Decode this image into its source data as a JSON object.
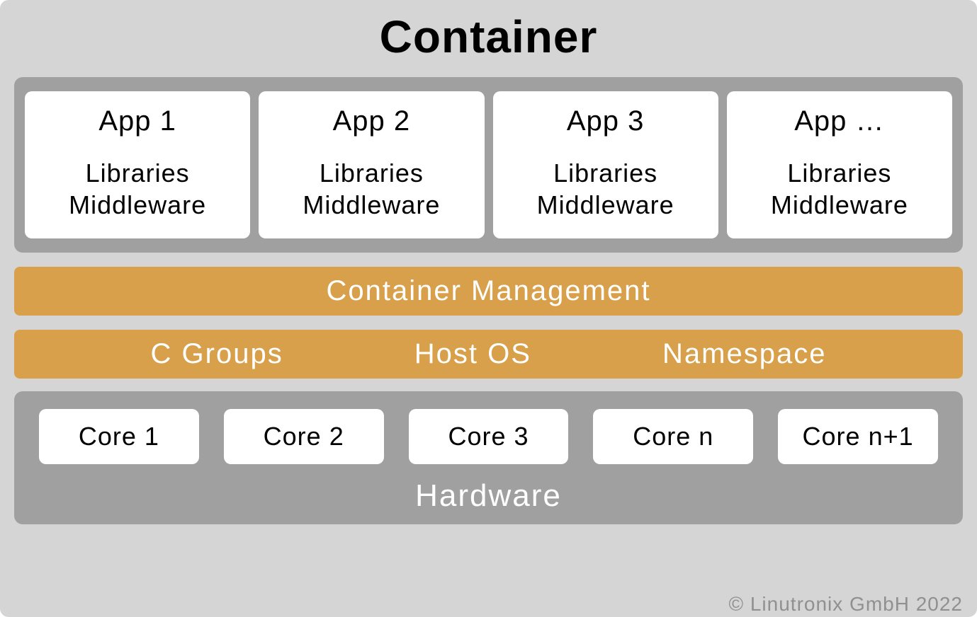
{
  "title": "Container",
  "apps": [
    {
      "name": "App 1",
      "line1": "Libraries",
      "line2": "Middleware"
    },
    {
      "name": "App 2",
      "line1": "Libraries",
      "line2": "Middleware"
    },
    {
      "name": "App 3",
      "line1": "Libraries",
      "line2": "Middleware"
    },
    {
      "name": "App …",
      "line1": "Libraries",
      "line2": "Middleware"
    }
  ],
  "management": "Container Management",
  "os_items": [
    "C Groups",
    "Host OS",
    "Namespace"
  ],
  "cores": [
    "Core 1",
    "Core 2",
    "Core 3",
    "Core n",
    "Core n+1"
  ],
  "hardware_label": "Hardware",
  "copyright": "© Linutronix GmbH 2022"
}
